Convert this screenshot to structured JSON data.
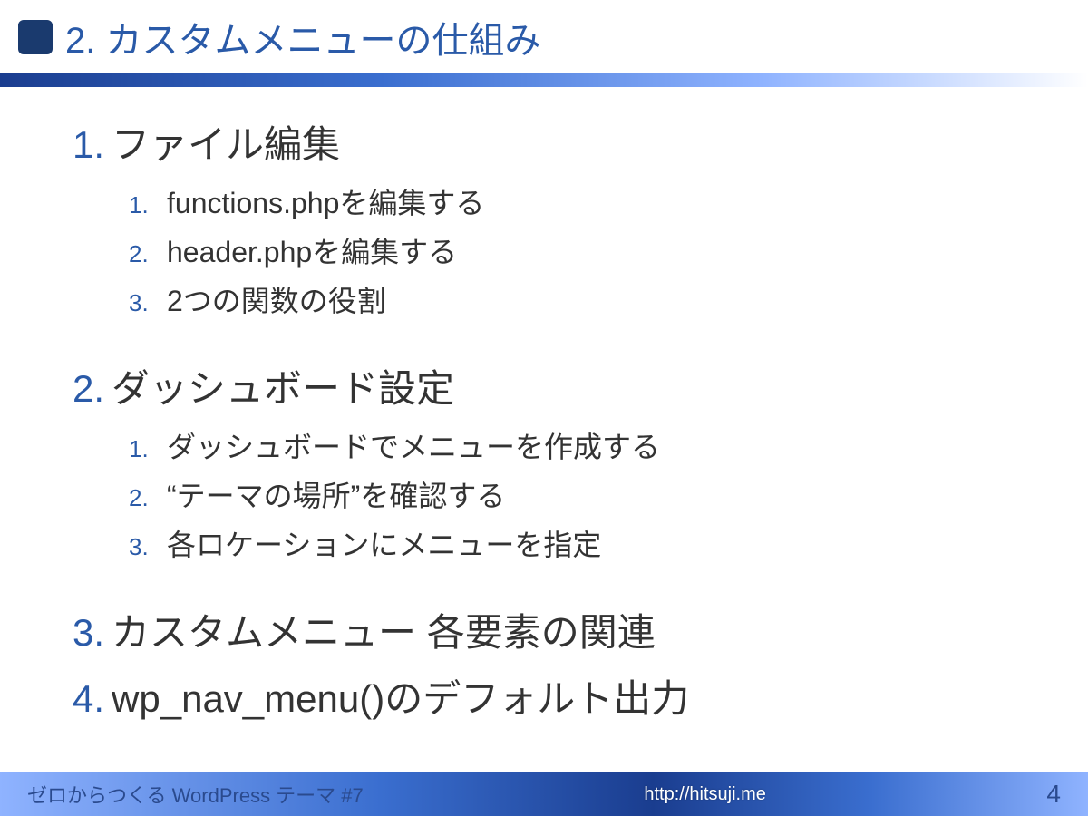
{
  "header": {
    "title": "2. カスタムメニューの仕組み"
  },
  "sections": [
    {
      "num": "1.",
      "title": "ファイル編集",
      "items": [
        {
          "num": "1.",
          "text": "functions.phpを編集する"
        },
        {
          "num": "2.",
          "text": "header.phpを編集する"
        },
        {
          "num": "3.",
          "text": "2つの関数の役割"
        }
      ]
    },
    {
      "num": "2.",
      "title": "ダッシュボード設定",
      "items": [
        {
          "num": "1.",
          "text": "ダッシュボードでメニューを作成する"
        },
        {
          "num": "2.",
          "text": "“テーマの場所”を確認する"
        },
        {
          "num": "3.",
          "text": "各ロケーションにメニューを指定"
        }
      ]
    },
    {
      "num": "3.",
      "title": "カスタムメニュー 各要素の関連",
      "items": []
    },
    {
      "num": "4.",
      "title": "wp_nav_menu()のデフォルト出力",
      "items": []
    }
  ],
  "footer": {
    "left": "ゼロからつくる WordPress テーマ #7",
    "center": "http://hitsuji.me",
    "page": "4"
  }
}
